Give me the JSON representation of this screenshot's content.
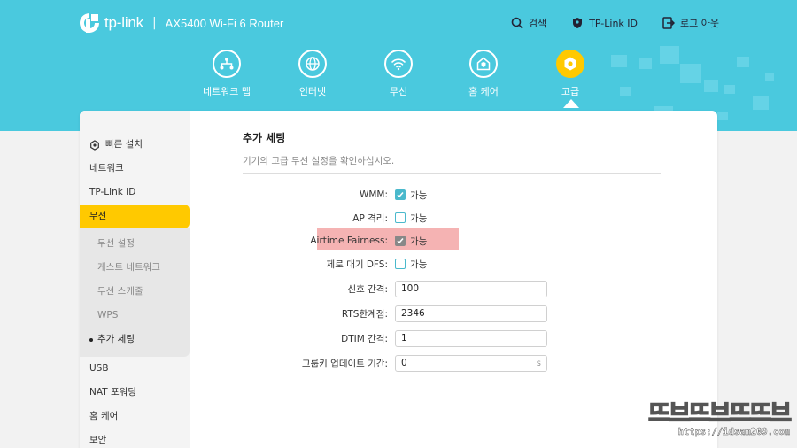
{
  "header": {
    "brand": "tp-link",
    "separator": "|",
    "model": "AX5400 Wi-Fi 6 Router",
    "actions": [
      {
        "label": "검색",
        "icon": "search-icon"
      },
      {
        "label": "TP-Link ID",
        "icon": "user-shield-icon"
      },
      {
        "label": "로그 아웃",
        "icon": "logout-icon"
      }
    ]
  },
  "nav": {
    "items": [
      {
        "label": "네트워크 맵",
        "icon": "network-map-icon"
      },
      {
        "label": "인터넷",
        "icon": "globe-icon"
      },
      {
        "label": "무선",
        "icon": "wifi-icon"
      },
      {
        "label": "홈 케어",
        "icon": "home-care-icon"
      },
      {
        "label": "고급",
        "icon": "gear-icon",
        "active": true
      }
    ]
  },
  "sidebar": {
    "items": [
      {
        "label": "빠른 설치",
        "icon": "quick-setup-icon"
      },
      {
        "label": "네트워크"
      },
      {
        "label": "TP-Link ID"
      },
      {
        "label": "무선",
        "active": true
      }
    ],
    "sub_items": [
      {
        "label": "무선 설정"
      },
      {
        "label": "게스트 네트워크"
      },
      {
        "label": "무선 스케줄"
      },
      {
        "label": "WPS"
      },
      {
        "label": "추가 세팅",
        "current": true
      }
    ],
    "items_after": [
      {
        "label": "USB"
      },
      {
        "label": "NAT 포워딩"
      },
      {
        "label": "홈 케어"
      },
      {
        "label": "보안"
      }
    ]
  },
  "main": {
    "title": "추가 세팅",
    "description": "기기의 고급 무선 설정을 확인하십시오.",
    "checkbox_rows": [
      {
        "label": "WMM:",
        "checked": true,
        "value_label": "가능"
      },
      {
        "label": "AP 격리:",
        "checked": false,
        "value_label": "가능"
      },
      {
        "label": "Airtime Fairness:",
        "checked": true,
        "value_label": "가능",
        "highlighted": true
      },
      {
        "label": "제로 대기 DFS:",
        "checked": false,
        "value_label": "가능"
      }
    ],
    "input_rows": [
      {
        "label": "신호 간격:",
        "value": "100",
        "unit": ""
      },
      {
        "label": "RTS한계점:",
        "value": "2346",
        "unit": ""
      },
      {
        "label": "DTIM 간격:",
        "value": "1",
        "unit": ""
      },
      {
        "label": "그룹키 업데이트 기간:",
        "value": "0",
        "unit": "s"
      }
    ]
  },
  "watermark": {
    "big": "뜨브뜨브뜨뜨브",
    "url": "https://idsam209.com"
  },
  "colors": {
    "header_bg": "#4ac9de",
    "accent": "#ffc900",
    "checkbox": "#4ab9cc",
    "highlight": "#f5b3b3"
  }
}
